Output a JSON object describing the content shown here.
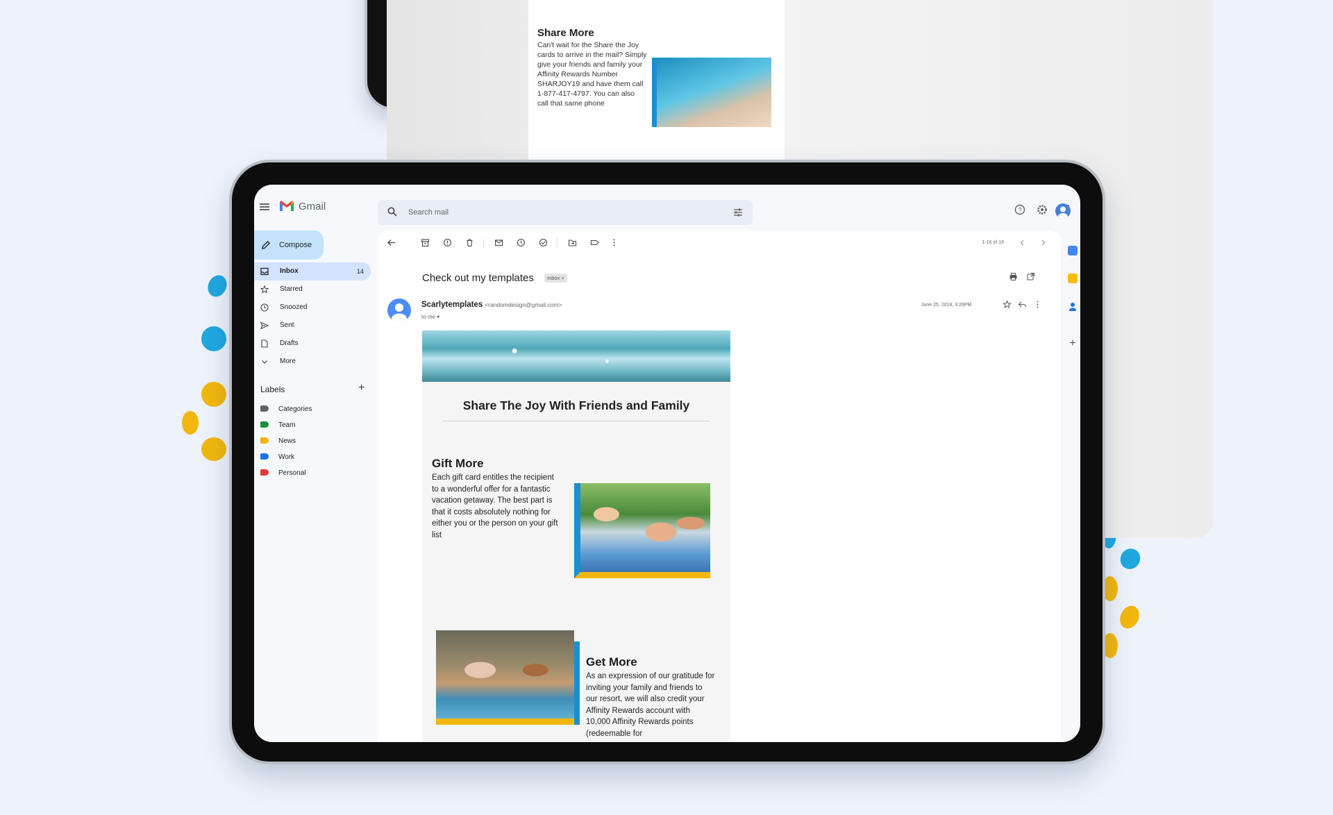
{
  "top_card": {
    "title": "Share More",
    "text": "Can't wait for the Share the Joy cards to arrive in the mail? Simply give your friends and family your Affinity Rewards Number SHARJOY19 and have them call 1-877-417-4797. You can also call that same phone"
  },
  "header": {
    "app_name": "Gmail",
    "search_placeholder": "Search mail"
  },
  "sidebar": {
    "compose_label": "Compose",
    "items": [
      {
        "label": "Inbox",
        "count": "14",
        "icon": "inbox-icon",
        "active": true
      },
      {
        "label": "Starred",
        "icon": "star-icon"
      },
      {
        "label": "Snoozed",
        "icon": "clock-icon"
      },
      {
        "label": "Sent",
        "icon": "send-icon"
      },
      {
        "label": "Drafts",
        "icon": "draft-icon"
      },
      {
        "label": "More",
        "icon": "chevron-down-icon"
      }
    ],
    "labels_heading": "Labels",
    "labels": [
      {
        "label": "Categories",
        "color": "#5f6368"
      },
      {
        "label": "Team",
        "color": "#1e8e3e"
      },
      {
        "label": "News",
        "color": "#f2b70d"
      },
      {
        "label": "Work",
        "color": "#1a73e8"
      },
      {
        "label": "Personal",
        "color": "#e53935"
      }
    ]
  },
  "message": {
    "pager": "1-16 of 16",
    "subject": "Check out my templates",
    "folder_chip": "Inbox ×",
    "sender_name": "Scarlytemplates",
    "sender_email": "<randomdesign@gmail.com>",
    "recipient": "to me ▾",
    "date": "June 25, 2018, 3:26PM"
  },
  "email": {
    "headline": "Share The Joy With Friends and Family",
    "gift_title": "Gift More",
    "gift_text": "Each gift card entitles the recipient to a wonderful offer for a fantastic vacation getaway. The best part is that it costs absolutely nothing for either you or the person on your gift list",
    "get_title": "Get More",
    "get_text": "As an expression of our gratitude for inviting your family and friends to our resort, we will also credit your Affinity Rewards account with 10,000 Affinity Rewards points (redeemable for"
  },
  "colors": {
    "accent_blue": "#1b8fd0",
    "accent_yellow": "#f1b80d",
    "background": "#eef3fb"
  }
}
